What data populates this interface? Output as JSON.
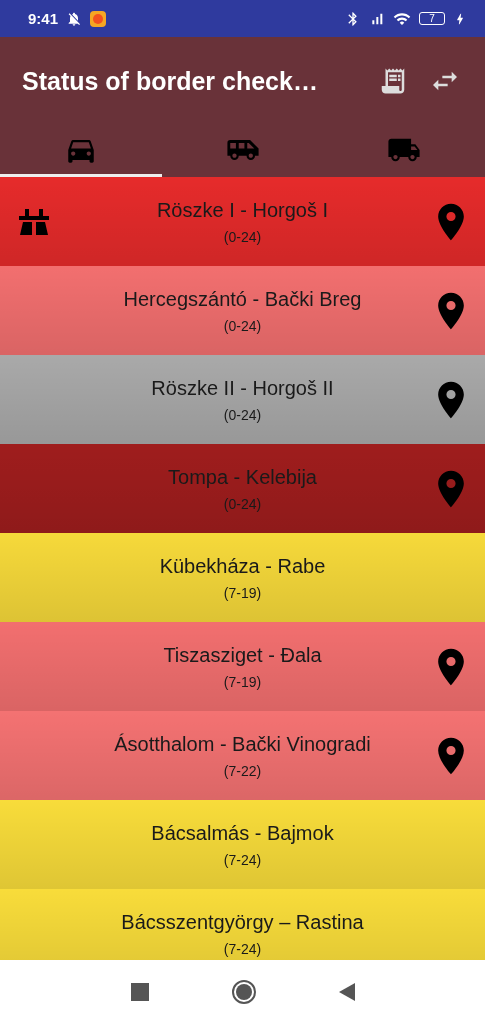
{
  "status_bar": {
    "time": "9:41",
    "battery": "7"
  },
  "app_bar": {
    "title": "Status of border check…"
  },
  "tabs": [
    {
      "kind": "car",
      "selected": true
    },
    {
      "kind": "van",
      "selected": false
    },
    {
      "kind": "truck",
      "selected": false
    }
  ],
  "crossings": [
    {
      "name": "Röszke I - Horgoš I",
      "hours": "(0-24)",
      "color": "#e62b2b",
      "motorway": true,
      "map_pin": true
    },
    {
      "name": "Hercegszántó - Bački Breg",
      "hours": "(0-24)",
      "color": "#f26f6f",
      "motorway": false,
      "map_pin": true
    },
    {
      "name": "Röszke II - Horgoš II",
      "hours": "(0-24)",
      "color": "#a9a9a9",
      "motorway": false,
      "map_pin": true
    },
    {
      "name": "Tompa - Kelebija",
      "hours": "(0-24)",
      "color": "#9f1d1d",
      "motorway": false,
      "map_pin": true
    },
    {
      "name": "Kübekháza - Rabe",
      "hours": "(7-19)",
      "color": "#f6d93a",
      "motorway": false,
      "map_pin": false
    },
    {
      "name": "Tiszasziget - Đala",
      "hours": "(7-19)",
      "color": "#f26f6f",
      "motorway": false,
      "map_pin": true
    },
    {
      "name": "Ásotthalom - Bački Vinogradi",
      "hours": "(7-22)",
      "color": "#f47272",
      "motorway": false,
      "map_pin": true
    },
    {
      "name": "Bácsalmás - Bajmok",
      "hours": "(7-24)",
      "color": "#f8dc3a",
      "motorway": false,
      "map_pin": false
    },
    {
      "name": "Bácsszentgyörgy – Rastina",
      "hours": "(7-24)",
      "color": "#f8dc3a",
      "motorway": false,
      "map_pin": false
    }
  ]
}
